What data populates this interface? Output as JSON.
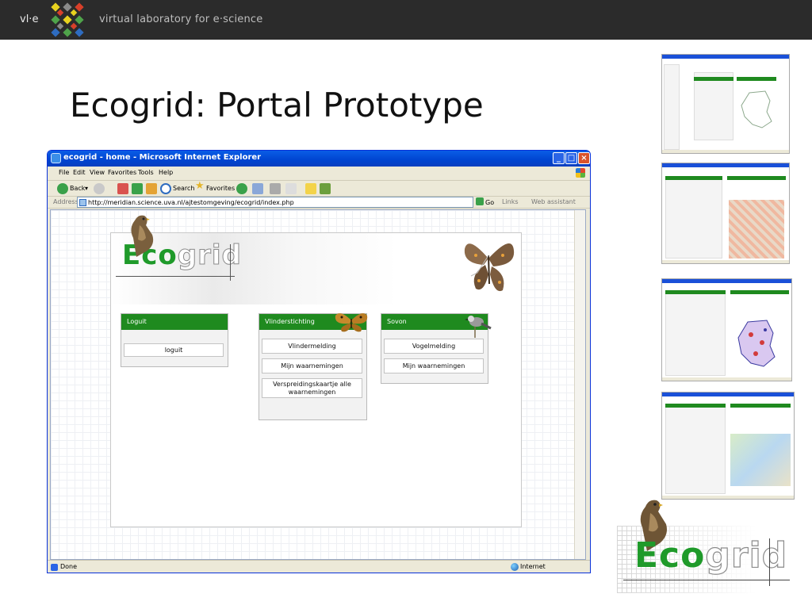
{
  "header": {
    "short_name": "vl·e",
    "org_name": "virtual laboratory for e·science",
    "logo_colors": [
      "#e8d21f",
      "#d8402a",
      "#4fa34a",
      "#2e6cc0",
      "#8a8a8a"
    ]
  },
  "slide": {
    "title": "Ecogrid: Portal Prototype"
  },
  "browser": {
    "title": "ecogrid - home - Microsoft Internet Explorer",
    "menu": [
      "File",
      "Edit",
      "View",
      "Favorites",
      "Tools",
      "Help"
    ],
    "toolbar": {
      "back": "Back",
      "search": "Search",
      "favorites": "Favorites"
    },
    "address": {
      "label": "Address",
      "url": "http://meridian.science.uva.nl/ajtestomgeving/ecogrid/index.php",
      "go": "Go",
      "links": "Links",
      "web_assistant": "Web assistant"
    },
    "status": {
      "text": "Done",
      "zone": "Internet"
    }
  },
  "portal": {
    "logo": {
      "part1": "Eco",
      "part2": "grid"
    },
    "panels": [
      {
        "title": "Loguit",
        "buttons": [
          "loguit"
        ]
      },
      {
        "title": "Vlinderstichting",
        "buttons": [
          "Vlindermelding",
          "Mijn waarnemingen",
          "Verspreidingskaartje alle waarnemingen"
        ]
      },
      {
        "title": "Sovon",
        "buttons": [
          "Vogelmelding",
          "Mijn waarnemingen"
        ]
      }
    ],
    "colors": {
      "header_green": "#1f8a1f",
      "eco_green": "#1f9a2a"
    }
  },
  "corner_logo": {
    "part1": "Eco",
    "part2": "grid"
  }
}
